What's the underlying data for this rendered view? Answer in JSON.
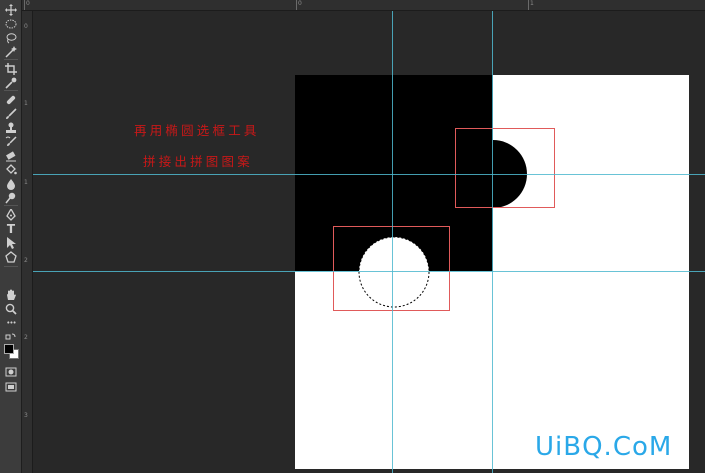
{
  "toolbar": {
    "tools": [
      {
        "name": "move-tool",
        "icon": "move-icon"
      },
      {
        "name": "elliptical-marquee-tool",
        "icon": "ellipse-marquee-icon"
      },
      {
        "name": "lasso-tool",
        "icon": "lasso-icon"
      },
      {
        "name": "magic-wand-tool",
        "icon": "magic-wand-icon"
      },
      {
        "name": "crop-tool",
        "icon": "crop-icon"
      },
      {
        "name": "eyedropper-tool",
        "icon": "eyedropper-icon"
      },
      {
        "name": "healing-brush-tool",
        "icon": "bandage-icon"
      },
      {
        "name": "brush-tool",
        "icon": "brush-icon"
      },
      {
        "name": "clone-stamp-tool",
        "icon": "stamp-icon"
      },
      {
        "name": "history-brush-tool",
        "icon": "history-brush-icon"
      },
      {
        "name": "eraser-tool",
        "icon": "eraser-icon"
      },
      {
        "name": "paint-bucket-tool",
        "icon": "bucket-icon"
      },
      {
        "name": "blur-tool",
        "icon": "drop-icon"
      },
      {
        "name": "dodge-tool",
        "icon": "dodge-icon"
      },
      {
        "name": "pen-tool",
        "icon": "pen-icon"
      },
      {
        "name": "type-tool",
        "icon": "type-icon",
        "label": "T"
      },
      {
        "name": "path-selection-tool",
        "icon": "arrow-icon"
      },
      {
        "name": "custom-shape-tool",
        "icon": "shape-icon"
      },
      {
        "name": "hand-tool",
        "icon": "hand-icon"
      },
      {
        "name": "zoom-tool",
        "icon": "zoom-icon"
      },
      {
        "name": "more-tools",
        "icon": "ellipsis-icon",
        "label": "•••"
      }
    ],
    "foreground_color": "#000000",
    "background_color": "#ffffff"
  },
  "ruler": {
    "top_labels": [
      "0",
      "0",
      "1"
    ],
    "left_labels": [
      "0",
      "1",
      "1",
      "2",
      "2",
      "3"
    ]
  },
  "canvas": {
    "caption_line1": "再用椭圆选框工具",
    "caption_line2": "拼接出拼图图案",
    "caption_color": "#c81818",
    "guide_color": "#4fb8cf",
    "selection_box_color": "#e05a5a"
  },
  "watermark": "UiBQ.CoM"
}
